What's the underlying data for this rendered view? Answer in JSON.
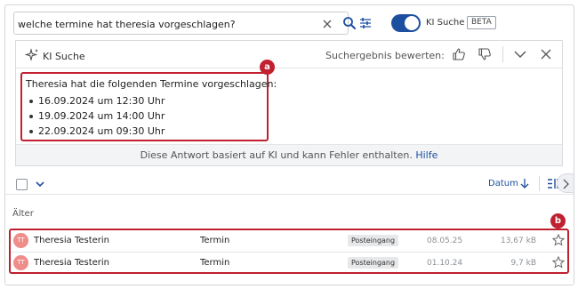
{
  "search": {
    "query": "welche termine hat theresia vorgeschlagen?"
  },
  "toggle": {
    "label": "KI Suche",
    "badge": "BETA",
    "enabled": true
  },
  "ki_panel": {
    "title": "KI Suche",
    "rate_label": "Suchergebnis bewerten:",
    "answer": {
      "intro": "Theresia hat die folgenden Termine vorgeschlagen:",
      "items": [
        "16.09.2024 um 12:30 Uhr",
        "19.09.2024 um 14:00 Uhr",
        "22.09.2024 um 09:30 Uhr"
      ]
    },
    "disclaimer": "Diese Antwort basiert auf KI und kann Fehler enthalten.",
    "help_link": "Hilfe"
  },
  "toolbar": {
    "sort_label": "Datum"
  },
  "list": {
    "group_label": "Älter",
    "rows": [
      {
        "initials": "TT",
        "sender": "Theresia Testerin",
        "subject": "Termin",
        "folder": "Posteingang",
        "date": "08.05.25",
        "size": "13,67 kB"
      },
      {
        "initials": "TT",
        "sender": "Theresia Testerin",
        "subject": "Termin",
        "folder": "Posteingang",
        "date": "01.10.24",
        "size": "9,7 kB"
      }
    ]
  },
  "annotations": {
    "a": "a",
    "b": "b"
  },
  "colors": {
    "accent": "#1d4fa0",
    "highlight": "#c0202f",
    "avatar": "#ee8d8a"
  }
}
